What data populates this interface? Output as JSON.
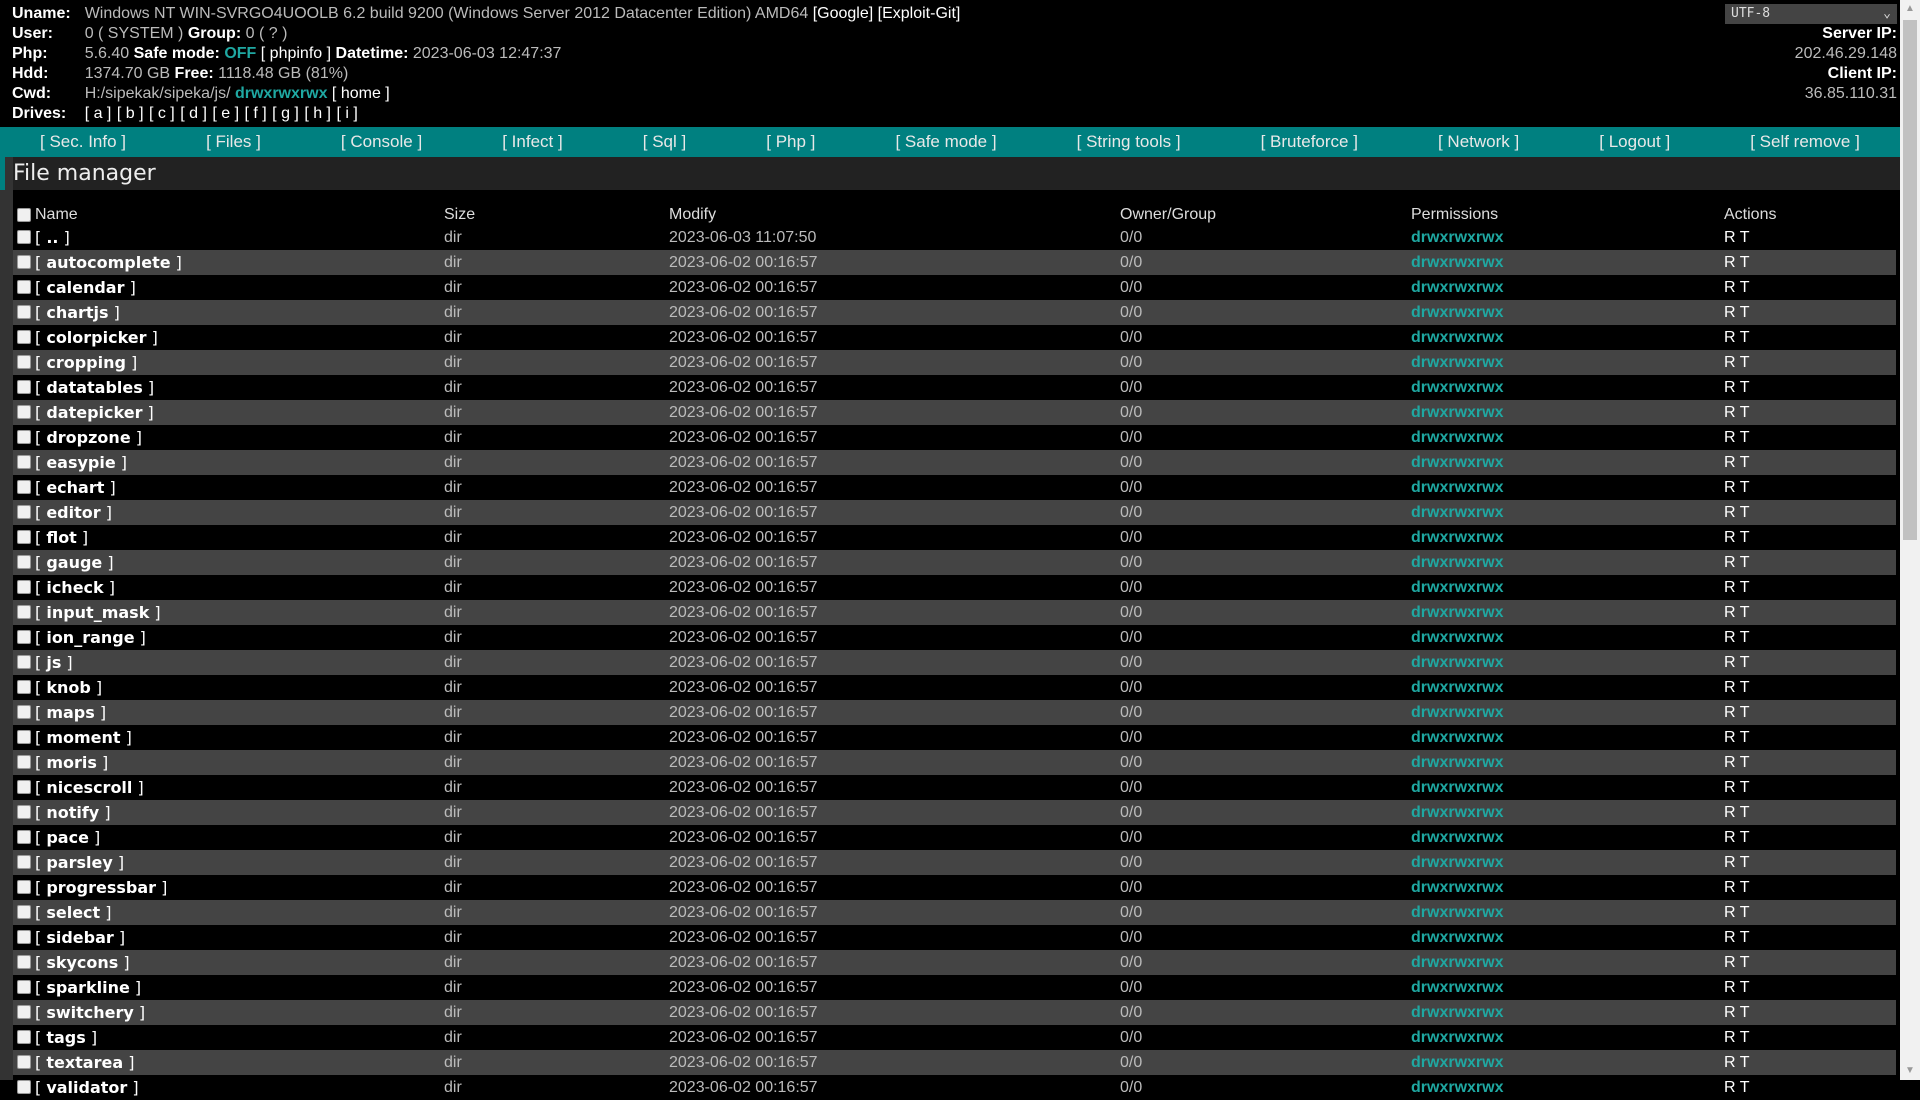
{
  "header": {
    "uname_label": "Uname:",
    "uname_value": "Windows NT WIN-SVRGO4UOOLB 6.2 build 9200 (Windows Server 2012 Datacenter Edition) AMD64",
    "google_link": "[Google]",
    "exploit_link": "[Exploit-Git]",
    "user_label": "User:",
    "user_value": "0 ( SYSTEM )",
    "group_label": "Group:",
    "group_value": "0 ( ? )",
    "php_label": "Php:",
    "php_version": "5.6.40",
    "safe_mode_label": "Safe mode:",
    "safe_mode_value": "OFF",
    "phpinfo_link": "[ phpinfo ]",
    "datetime_label": "Datetime:",
    "datetime_value": "2023-06-03 12:47:37",
    "hdd_label": "Hdd:",
    "hdd_value": "1374.70 GB",
    "free_label": "Free:",
    "free_value": "1118.48 GB (81%)",
    "cwd_label": "Cwd:",
    "cwd_path": "H:/sipekak/sipeka/js/",
    "cwd_perms": "drwxrwxrwx",
    "home_link": "[ home ]",
    "drives_label": "Drives:",
    "drives": [
      "[ a ]",
      "[ b ]",
      "[ c ]",
      "[ d ]",
      "[ e ]",
      "[ f ]",
      "[ g ]",
      "[ h ]",
      "[ i ]"
    ],
    "encoding": "UTF-8",
    "server_ip_label": "Server IP:",
    "server_ip": "202.46.29.148",
    "client_ip_label": "Client IP:",
    "client_ip": "36.85.110.31"
  },
  "nav": [
    "[ Sec. Info ]",
    "[ Files ]",
    "[ Console ]",
    "[ Infect ]",
    "[ Sql ]",
    "[ Php ]",
    "[ Safe mode ]",
    "[ String tools ]",
    "[ Bruteforce ]",
    "[ Network ]",
    "[ Logout ]",
    "[ Self remove ]"
  ],
  "file_manager": {
    "title": "File manager",
    "columns": [
      "Name",
      "Size",
      "Modify",
      "Owner/Group",
      "Permissions",
      "Actions"
    ],
    "rows": [
      {
        "name": "..",
        "size": "dir",
        "modify": "2023-06-03 11:07:50",
        "owner": "0/0",
        "perms": "drwxrwxrwx",
        "actions": "R T"
      },
      {
        "name": "autocomplete",
        "size": "dir",
        "modify": "2023-06-02 00:16:57",
        "owner": "0/0",
        "perms": "drwxrwxrwx",
        "actions": "R T"
      },
      {
        "name": "calendar",
        "size": "dir",
        "modify": "2023-06-02 00:16:57",
        "owner": "0/0",
        "perms": "drwxrwxrwx",
        "actions": "R T"
      },
      {
        "name": "chartjs",
        "size": "dir",
        "modify": "2023-06-02 00:16:57",
        "owner": "0/0",
        "perms": "drwxrwxrwx",
        "actions": "R T"
      },
      {
        "name": "colorpicker",
        "size": "dir",
        "modify": "2023-06-02 00:16:57",
        "owner": "0/0",
        "perms": "drwxrwxrwx",
        "actions": "R T"
      },
      {
        "name": "cropping",
        "size": "dir",
        "modify": "2023-06-02 00:16:57",
        "owner": "0/0",
        "perms": "drwxrwxrwx",
        "actions": "R T"
      },
      {
        "name": "datatables",
        "size": "dir",
        "modify": "2023-06-02 00:16:57",
        "owner": "0/0",
        "perms": "drwxrwxrwx",
        "actions": "R T"
      },
      {
        "name": "datepicker",
        "size": "dir",
        "modify": "2023-06-02 00:16:57",
        "owner": "0/0",
        "perms": "drwxrwxrwx",
        "actions": "R T"
      },
      {
        "name": "dropzone",
        "size": "dir",
        "modify": "2023-06-02 00:16:57",
        "owner": "0/0",
        "perms": "drwxrwxrwx",
        "actions": "R T"
      },
      {
        "name": "easypie",
        "size": "dir",
        "modify": "2023-06-02 00:16:57",
        "owner": "0/0",
        "perms": "drwxrwxrwx",
        "actions": "R T"
      },
      {
        "name": "echart",
        "size": "dir",
        "modify": "2023-06-02 00:16:57",
        "owner": "0/0",
        "perms": "drwxrwxrwx",
        "actions": "R T"
      },
      {
        "name": "editor",
        "size": "dir",
        "modify": "2023-06-02 00:16:57",
        "owner": "0/0",
        "perms": "drwxrwxrwx",
        "actions": "R T"
      },
      {
        "name": "flot",
        "size": "dir",
        "modify": "2023-06-02 00:16:57",
        "owner": "0/0",
        "perms": "drwxrwxrwx",
        "actions": "R T"
      },
      {
        "name": "gauge",
        "size": "dir",
        "modify": "2023-06-02 00:16:57",
        "owner": "0/0",
        "perms": "drwxrwxrwx",
        "actions": "R T"
      },
      {
        "name": "icheck",
        "size": "dir",
        "modify": "2023-06-02 00:16:57",
        "owner": "0/0",
        "perms": "drwxrwxrwx",
        "actions": "R T"
      },
      {
        "name": "input_mask",
        "size": "dir",
        "modify": "2023-06-02 00:16:57",
        "owner": "0/0",
        "perms": "drwxrwxrwx",
        "actions": "R T"
      },
      {
        "name": "ion_range",
        "size": "dir",
        "modify": "2023-06-02 00:16:57",
        "owner": "0/0",
        "perms": "drwxrwxrwx",
        "actions": "R T"
      },
      {
        "name": "js",
        "size": "dir",
        "modify": "2023-06-02 00:16:57",
        "owner": "0/0",
        "perms": "drwxrwxrwx",
        "actions": "R T"
      },
      {
        "name": "knob",
        "size": "dir",
        "modify": "2023-06-02 00:16:57",
        "owner": "0/0",
        "perms": "drwxrwxrwx",
        "actions": "R T"
      },
      {
        "name": "maps",
        "size": "dir",
        "modify": "2023-06-02 00:16:57",
        "owner": "0/0",
        "perms": "drwxrwxrwx",
        "actions": "R T"
      },
      {
        "name": "moment",
        "size": "dir",
        "modify": "2023-06-02 00:16:57",
        "owner": "0/0",
        "perms": "drwxrwxrwx",
        "actions": "R T"
      },
      {
        "name": "moris",
        "size": "dir",
        "modify": "2023-06-02 00:16:57",
        "owner": "0/0",
        "perms": "drwxrwxrwx",
        "actions": "R T"
      },
      {
        "name": "nicescroll",
        "size": "dir",
        "modify": "2023-06-02 00:16:57",
        "owner": "0/0",
        "perms": "drwxrwxrwx",
        "actions": "R T"
      },
      {
        "name": "notify",
        "size": "dir",
        "modify": "2023-06-02 00:16:57",
        "owner": "0/0",
        "perms": "drwxrwxrwx",
        "actions": "R T"
      },
      {
        "name": "pace",
        "size": "dir",
        "modify": "2023-06-02 00:16:57",
        "owner": "0/0",
        "perms": "drwxrwxrwx",
        "actions": "R T"
      },
      {
        "name": "parsley",
        "size": "dir",
        "modify": "2023-06-02 00:16:57",
        "owner": "0/0",
        "perms": "drwxrwxrwx",
        "actions": "R T"
      },
      {
        "name": "progressbar",
        "size": "dir",
        "modify": "2023-06-02 00:16:57",
        "owner": "0/0",
        "perms": "drwxrwxrwx",
        "actions": "R T"
      },
      {
        "name": "select",
        "size": "dir",
        "modify": "2023-06-02 00:16:57",
        "owner": "0/0",
        "perms": "drwxrwxrwx",
        "actions": "R T"
      },
      {
        "name": "sidebar",
        "size": "dir",
        "modify": "2023-06-02 00:16:57",
        "owner": "0/0",
        "perms": "drwxrwxrwx",
        "actions": "R T"
      },
      {
        "name": "skycons",
        "size": "dir",
        "modify": "2023-06-02 00:16:57",
        "owner": "0/0",
        "perms": "drwxrwxrwx",
        "actions": "R T"
      },
      {
        "name": "sparkline",
        "size": "dir",
        "modify": "2023-06-02 00:16:57",
        "owner": "0/0",
        "perms": "drwxrwxrwx",
        "actions": "R T"
      },
      {
        "name": "switchery",
        "size": "dir",
        "modify": "2023-06-02 00:16:57",
        "owner": "0/0",
        "perms": "drwxrwxrwx",
        "actions": "R T"
      },
      {
        "name": "tags",
        "size": "dir",
        "modify": "2023-06-02 00:16:57",
        "owner": "0/0",
        "perms": "drwxrwxrwx",
        "actions": "R T"
      },
      {
        "name": "textarea",
        "size": "dir",
        "modify": "2023-06-02 00:16:57",
        "owner": "0/0",
        "perms": "drwxrwxrwx",
        "actions": "R T"
      },
      {
        "name": "validator",
        "size": "dir",
        "modify": "2023-06-02 00:16:57",
        "owner": "0/0",
        "perms": "drwxrwxrwx",
        "actions": "R T"
      }
    ]
  },
  "colors": {
    "accent": "#008080",
    "perm_green": "#1fa8a2",
    "row_alt": "#444444"
  }
}
